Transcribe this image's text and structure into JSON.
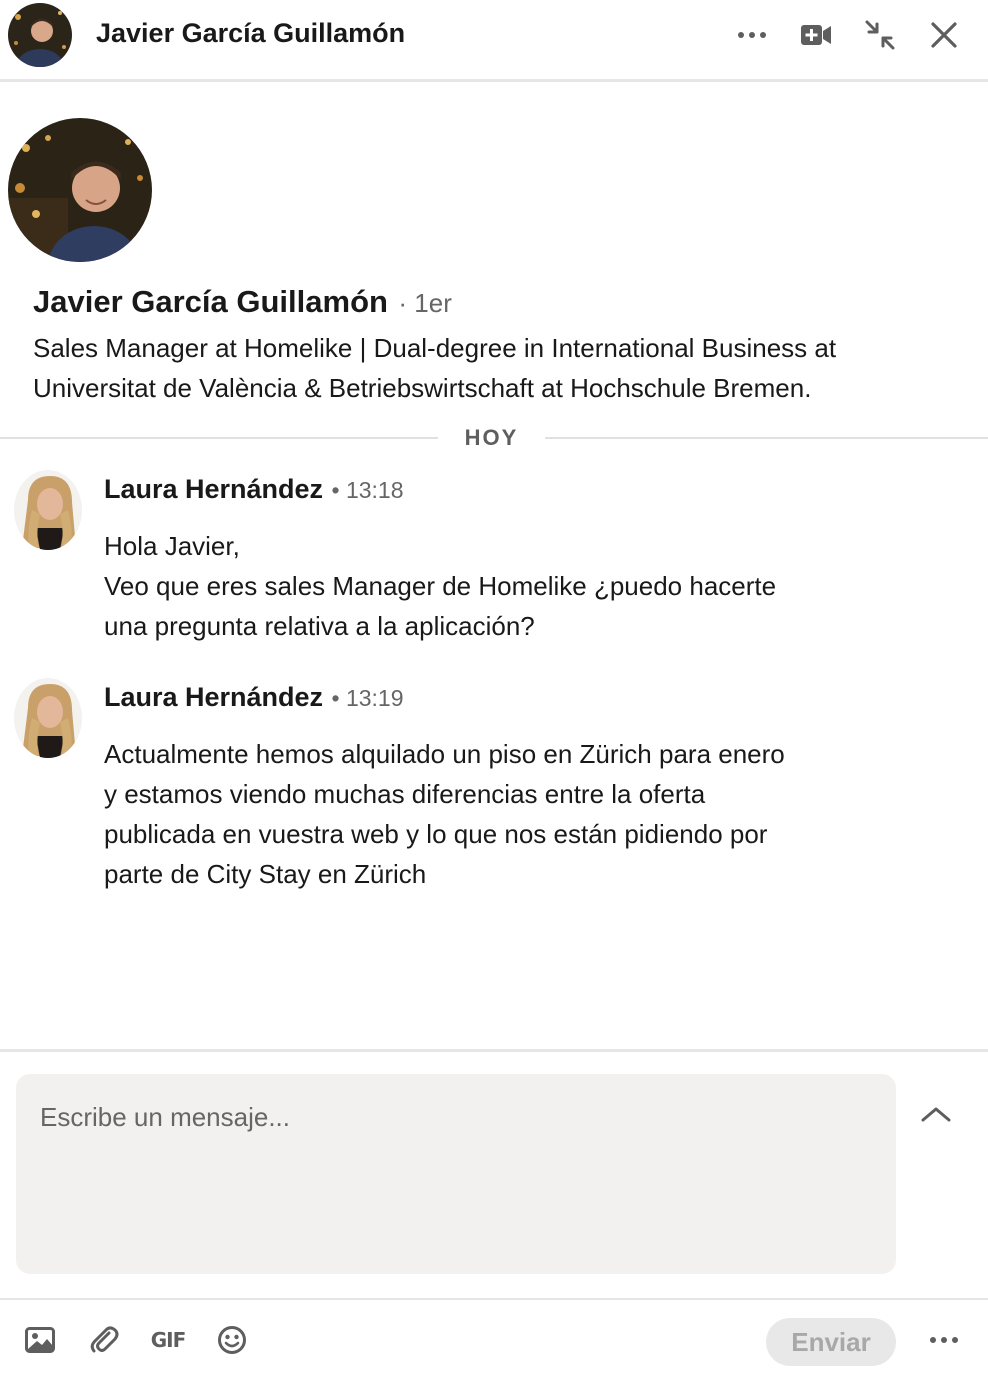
{
  "header": {
    "title": "Javier García Guillamón"
  },
  "profile": {
    "name": "Javier García Guillamón",
    "degree": "· 1er",
    "headline": "Sales Manager at Homelike | Dual-degree in International Business at Universitat de València & Betriebswirtschaft at Hochschule Bremen."
  },
  "thread": {
    "day_label": "HOY",
    "messages": [
      {
        "sender": "Laura Hernández",
        "time": "• 13:18",
        "lines": [
          "Hola Javier,",
          "Veo que eres sales Manager de Homelike ¿puedo hacerte",
          "una pregunta relativa a la aplicación?"
        ]
      },
      {
        "sender": "Laura Hernández",
        "time": "• 13:19",
        "lines": [
          "Actualmente hemos alquilado un piso en Zürich para enero",
          "y estamos viendo muchas diferencias entre la oferta",
          "publicada en vuestra web y lo que nos están pidiendo por",
          "parte de City Stay en Zürich"
        ]
      }
    ]
  },
  "compose": {
    "placeholder": "Escribe un mensaje...",
    "gif_label": "GIF",
    "send_label": "Enviar"
  },
  "icons": {
    "more": "ellipsis-icon",
    "video": "video-call-icon",
    "minimize": "collapse-arrows-icon",
    "close": "close-icon",
    "expand": "chevron-up-icon",
    "image": "image-icon",
    "attach": "paperclip-icon",
    "emoji": "emoji-icon"
  },
  "colors": {
    "text_primary": "#191919",
    "text_secondary": "#666666",
    "compose_bg": "#f2f1ef",
    "send_disabled_bg": "#e8e8e8"
  }
}
